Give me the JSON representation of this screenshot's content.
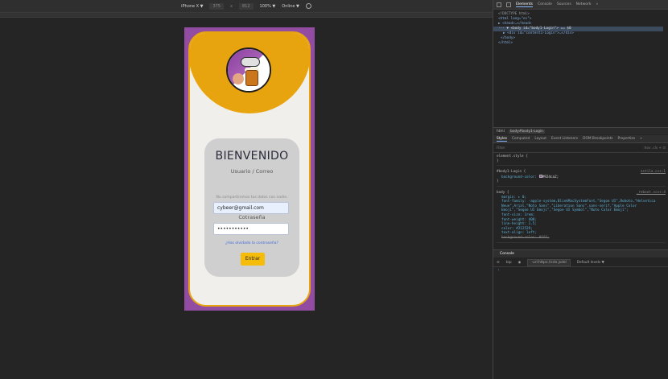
{
  "device_toolbar": {
    "device": "iPhone X ▼",
    "width": "375",
    "times": "x",
    "height": "812",
    "zoom": "100% ▼",
    "network": "Online ▼"
  },
  "login": {
    "title": "BIENVENIDO",
    "user_label": "Usuario / Correo",
    "email_value": "cybeer@gmail.com",
    "privacy_hint": "Nu compartiremos tus datos con nadie.",
    "password_label": "Cotraseña",
    "password_value": "•••••••••••",
    "forgot_link": "¿Has olvidado la contraseña?",
    "submit": "Entrar"
  },
  "devtools": {
    "tabs": [
      "Elements",
      "Console",
      "Sources",
      "Network",
      "»"
    ],
    "dom": [
      "<!DOCTYPE html>",
      "<html lang=\"es\">",
      "▶ <head>…</head>",
      "··· ▼ <body id=\"body1-Login\"> == $0",
      "▶ <div id=\"content1-Login\">…</div>",
      "</body>",
      "</html>"
    ],
    "breadcrumb": [
      "html",
      "body#body1-Login"
    ],
    "style_tabs": [
      "Styles",
      "Computed",
      "Layout",
      "Event Listeners",
      "DOM Breakpoints",
      "Properties",
      "»"
    ],
    "filter_placeholder": "Filter",
    "filter_tools": ":hov .cls + ⊡",
    "element_style": "element.style {",
    "rule1_selector": "#body1-Login {",
    "rule1_source": "estilo.css:1",
    "rule1_prop": "background-color:",
    "rule1_val": "#924ca2;",
    "rule2_selector": "body {",
    "rule2_source": "_reboot.scss:4",
    "rule2_lines": [
      "margin: ▸ 0;",
      "font-family: -apple-system,BlinkMacSystemFont,\"Segoe UI\",Roboto,\"Helvetica Neue\",Arial,\"Noto Sans\",\"Liberation Sans\",sans-serif,\"Apple Color Emoji\",\"Segoe UI Emoji\",\"Segoe UI Symbol\",\"Noto Color Emoji\";",
      "font-size: 1rem;",
      "font-weight: 400;",
      "line-height: 1.5;",
      "color: #212529;",
      "text-align: left;"
    ],
    "rule2_struck": "background-color: #fff;",
    "console_title": "Console",
    "console_context": "top",
    "console_filter": "-url:https://cdn.jsdel",
    "console_levels": "Default levels ▼",
    "prompt": "›"
  },
  "colors": {
    "page_bg": "#924ca2",
    "accent": "#e8a40e",
    "button": "#f5bd0a"
  }
}
